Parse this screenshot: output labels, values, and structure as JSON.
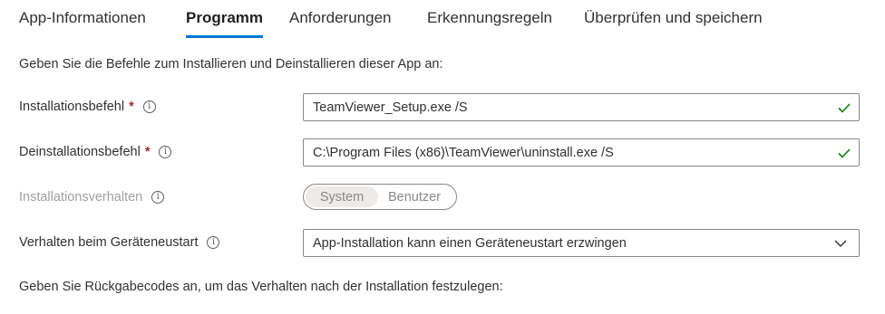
{
  "tabs": [
    {
      "label": "App-Informationen"
    },
    {
      "label": "Programm"
    },
    {
      "label": "Anforderungen"
    },
    {
      "label": "Erkennungsregeln"
    },
    {
      "label": "Überprüfen und speichern"
    }
  ],
  "active_tab": "Programm",
  "intro_text": "Geben Sie die Befehle zum Installieren und Deinstallieren dieser App an:",
  "install_command": {
    "label": "Installationsbefehl",
    "required_mark": "*",
    "value": "TeamViewer_Setup.exe /S",
    "valid": true
  },
  "uninstall_command": {
    "label": "Deinstallationsbefehl",
    "required_mark": "*",
    "value": "C:\\Program Files (x86)\\TeamViewer\\uninstall.exe /S",
    "valid": true
  },
  "install_behavior": {
    "label": "Installationsverhalten",
    "disabled": true,
    "options": [
      "System",
      "Benutzer"
    ],
    "selected": "System"
  },
  "restart_behavior": {
    "label": "Verhalten beim Geräteneustart",
    "selected": "App-Installation kann einen Geräteneustart erzwingen"
  },
  "return_codes_text": "Geben Sie Rückgabecodes an, um das Verhalten nach der Installation festzulegen:",
  "colors": {
    "accent": "#0078d4",
    "required": "#a4262c",
    "valid_check": "#107c10",
    "disabled_text": "#a19f9d"
  },
  "icons": {
    "info": "info-icon",
    "check": "checkmark-icon",
    "dropdown": "chevron-down-icon"
  }
}
